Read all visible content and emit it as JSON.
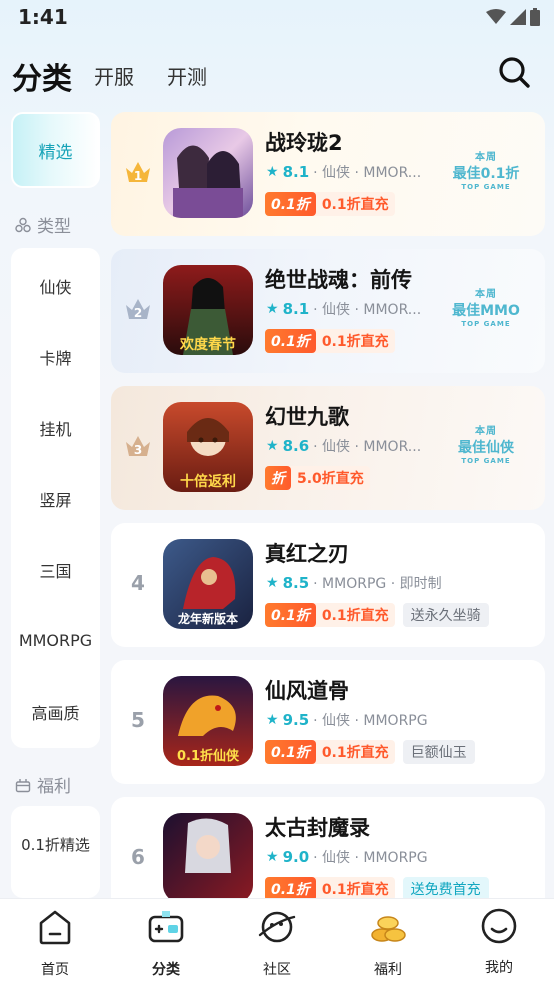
{
  "status": {
    "time": "1:41"
  },
  "header": {
    "tab_active": "分类",
    "tab_2": "开服",
    "tab_3": "开测"
  },
  "sidebar": {
    "selected": "精选",
    "heading_type": "类型",
    "types": [
      "仙侠",
      "卡牌",
      "挂机",
      "竖屏",
      "三国",
      "MMORPG",
      "高画质"
    ],
    "heading_welfare": "福利",
    "welfare_items": [
      "0.1折精选"
    ]
  },
  "games": [
    {
      "rank": "1",
      "name": "战玲珑2",
      "score": "8.1",
      "meta": "· 仙侠 · MMOR...",
      "disc_logo": "0.1折",
      "disc_text": "0.1折直充",
      "award": {
        "line1": "本周",
        "line2": "最佳0.1折",
        "line3": "TOP GAME"
      }
    },
    {
      "rank": "2",
      "name": "绝世战魂：前传",
      "score": "8.1",
      "meta": "· 仙侠 · MMOR...",
      "disc_logo": "0.1折",
      "disc_text": "0.1折直充",
      "award": {
        "line1": "本周",
        "line2": "最佳MMO",
        "line3": "TOP GAME"
      },
      "icon_caption": "欢度春节"
    },
    {
      "rank": "3",
      "name": "幻世九歌",
      "score": "8.6",
      "meta": "· 仙侠 · MMOR...",
      "disc_logo": "折",
      "disc_text": "5.0折直充",
      "award": {
        "line1": "本周",
        "line2": "最佳仙侠",
        "line3": "TOP GAME"
      },
      "icon_caption": "十倍返利"
    },
    {
      "rank": "4",
      "name": "真红之刃",
      "score": "8.5",
      "meta": "· MMORPG · 即时制",
      "disc_logo": "0.1折",
      "disc_text": "0.1折直充",
      "extra": "送永久坐骑",
      "icon_caption": "龙年新版本"
    },
    {
      "rank": "5",
      "name": "仙风道骨",
      "score": "9.5",
      "meta": "· 仙侠 · MMORPG",
      "disc_logo": "0.1折",
      "disc_text": "0.1折直充",
      "extra": "巨额仙玉",
      "icon_caption": "0.1折仙侠"
    },
    {
      "rank": "6",
      "name": "太古封魔录",
      "score": "9.0",
      "meta": "· 仙侠 · MMORPG",
      "disc_logo": "0.1折",
      "disc_text": "0.1折直充",
      "extra": "送免费首充"
    }
  ],
  "nav": [
    {
      "label": "首页",
      "icon": "home-icon"
    },
    {
      "label": "分类",
      "icon": "gamepad-icon"
    },
    {
      "label": "社区",
      "icon": "planet-icon"
    },
    {
      "label": "福利",
      "icon": "coins-icon"
    },
    {
      "label": "我的",
      "icon": "smile-icon"
    }
  ],
  "colors": {
    "accent": "#1fb3c9",
    "discount": "#ff5a2c"
  }
}
